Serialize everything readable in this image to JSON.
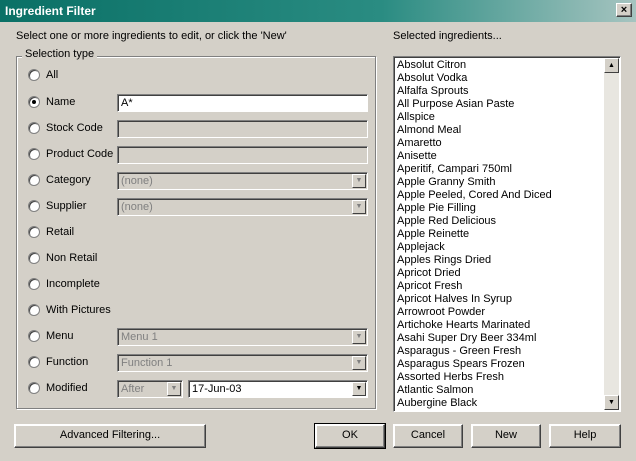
{
  "window": {
    "title": "Ingredient Filter",
    "close_glyph": "×"
  },
  "instruction": "Select one or more ingredients to edit, or click the 'New'",
  "selected_label": "Selected ingredients...",
  "selection_type": {
    "legend": "Selection type",
    "options": [
      {
        "label": "All",
        "checked": false
      },
      {
        "label": "Name",
        "checked": true
      },
      {
        "label": "Stock Code",
        "checked": false
      },
      {
        "label": "Product Code",
        "checked": false
      },
      {
        "label": "Category",
        "checked": false
      },
      {
        "label": "Supplier",
        "checked": false
      },
      {
        "label": "Retail",
        "checked": false
      },
      {
        "label": "Non Retail",
        "checked": false
      },
      {
        "label": "Incomplete",
        "checked": false
      },
      {
        "label": "With Pictures",
        "checked": false
      },
      {
        "label": "Menu",
        "checked": false
      },
      {
        "label": "Function",
        "checked": false
      },
      {
        "label": "Modified",
        "checked": false
      }
    ]
  },
  "fields": {
    "name_value": "A*",
    "stock_code_value": "",
    "product_code_value": "",
    "category_value": "(none)",
    "supplier_value": "(none)",
    "menu_value": "Menu 1",
    "function_value": "Function 1",
    "modified_comparator": "After",
    "modified_date": "17-Jun-03"
  },
  "ingredients": [
    "Absolut Citron",
    "Absolut Vodka",
    "Alfalfa Sprouts",
    "All Purpose Asian Paste",
    "Allspice",
    "Almond Meal",
    "Amaretto",
    "Anisette",
    "Aperitif, Campari  750ml",
    "Apple Granny Smith",
    "Apple Peeled, Cored And Diced",
    "Apple Pie Filling",
    "Apple Red Delicious",
    "Apple Reinette",
    "Applejack",
    "Apples Rings Dried",
    "Apricot Dried",
    "Apricot Fresh",
    "Apricot Halves In Syrup",
    "Arrowroot Powder",
    "Artichoke Hearts Marinated",
    "Asahi Super Dry Beer 334ml",
    "Asparagus - Green Fresh",
    "Asparagus Spears Frozen",
    "Assorted Herbs Fresh",
    "Atlantic Salmon",
    "Aubergine Black"
  ],
  "buttons": {
    "advanced": "Advanced Filtering...",
    "ok": "OK",
    "cancel": "Cancel",
    "new": "New",
    "help": "Help"
  },
  "icons": {
    "dropdown": "▼",
    "scroll_up": "▲",
    "scroll_down": "▼"
  }
}
